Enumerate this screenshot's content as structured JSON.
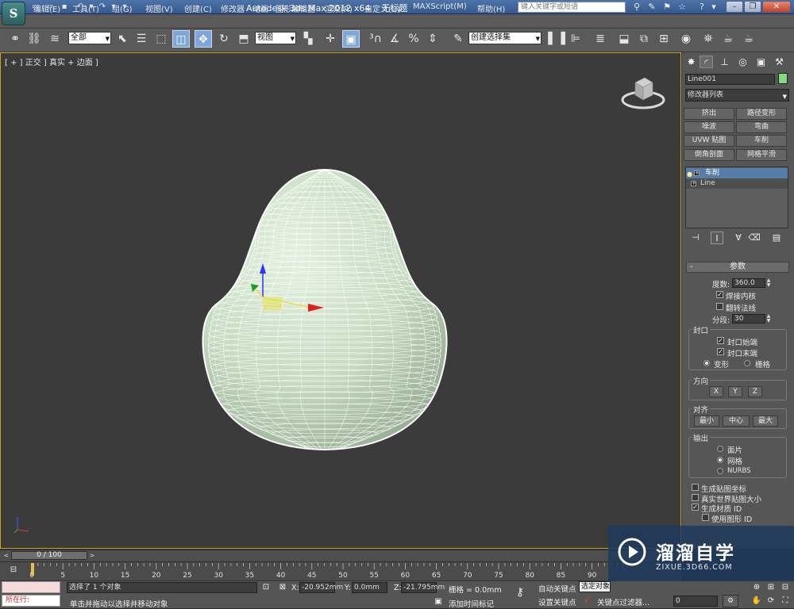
{
  "titlebar": {
    "app_title": "Autodesk 3ds Max  2012 x64",
    "doc_title": "无标题",
    "search_placeholder": "键入关键字或短语",
    "app_logo": "S"
  },
  "menu": [
    "编辑(E)",
    "工具(T)",
    "组(G)",
    "视图(V)",
    "创建(C)",
    "修改器",
    "动画",
    "图形编辑器",
    "渲染(R)",
    "自定义(U)",
    "MAXScript(M)",
    "帮助(H)"
  ],
  "toolbar": {
    "selection_filter": "全部",
    "reference_coord": "视图",
    "named_selection": "创建选择集"
  },
  "viewport": {
    "label": "[ + ] 正交 ] 真实 + 边面 ]",
    "mesh_fill": "#c9dfc4",
    "wire_color": "#ffffff"
  },
  "command_panel": {
    "object_name": "Line001",
    "object_color": "#84d784",
    "modifier_list": "修改器列表",
    "modifier_buttons": [
      [
        "挤出",
        "路径变形"
      ],
      [
        "噪波",
        "弯曲"
      ],
      [
        "UVW 贴图",
        "车削"
      ],
      [
        "倒角剖面",
        "网格平滑"
      ]
    ],
    "stack": [
      {
        "label": "车削",
        "selected": true
      },
      {
        "label": "Line",
        "selected": false
      }
    ],
    "rollout_title": "参数",
    "degrees_label": "度数:",
    "degrees_value": "360.0",
    "weld_core": "焊接内核",
    "flip_normals": "翻转法线",
    "segments_label": "分段:",
    "segments_value": "30",
    "capping": {
      "title": "封口",
      "cap_start": "封口始端",
      "cap_end": "封口末端",
      "morph": "变形",
      "grid": "栅格"
    },
    "direction": {
      "title": "方向",
      "x": "X",
      "y": "Y",
      "z": "Z"
    },
    "align": {
      "title": "对齐",
      "min": "最小",
      "center": "中心",
      "max": "最大"
    },
    "output": {
      "title": "输出",
      "patch": "面片",
      "mesh": "网格",
      "nurbs": "NURBS"
    },
    "gen_map_coords": "生成贴图坐标",
    "real_world": "真实世界贴图大小",
    "gen_mat_ids": "生成材质 ID",
    "use_shape_ids": "使用图形 ID"
  },
  "timeline": {
    "frame_display": "0 / 100",
    "tick_labels": [
      "0",
      "5",
      "10",
      "15",
      "20",
      "25",
      "30",
      "35",
      "40",
      "45",
      "50",
      "55",
      "60",
      "65",
      "70",
      "75",
      "80",
      "85",
      "90"
    ]
  },
  "status": {
    "maxscript_prompt": "所在行:",
    "selected_text": "选择了 1 个对象",
    "prompt_text": "单击并拖动以选择并移动对象",
    "x_label": "X:",
    "x_value": "-20.952mm",
    "y_label": "Y:",
    "y_value": "0.0mm",
    "z_label": "Z:",
    "z_value": "-21.795mm",
    "grid_text": "栅格 = 0.0mm",
    "add_time_tag": "添加时间标记",
    "auto_key": "自动关键点",
    "selected_obj": "选定对象",
    "set_key": "设置关键点",
    "key_filters": "关键点过滤器...",
    "current_frame": "0"
  },
  "watermark": {
    "title": "溜溜自学",
    "url": "ZIXUE.3D66.COM",
    "color": "#1e3a5c"
  }
}
